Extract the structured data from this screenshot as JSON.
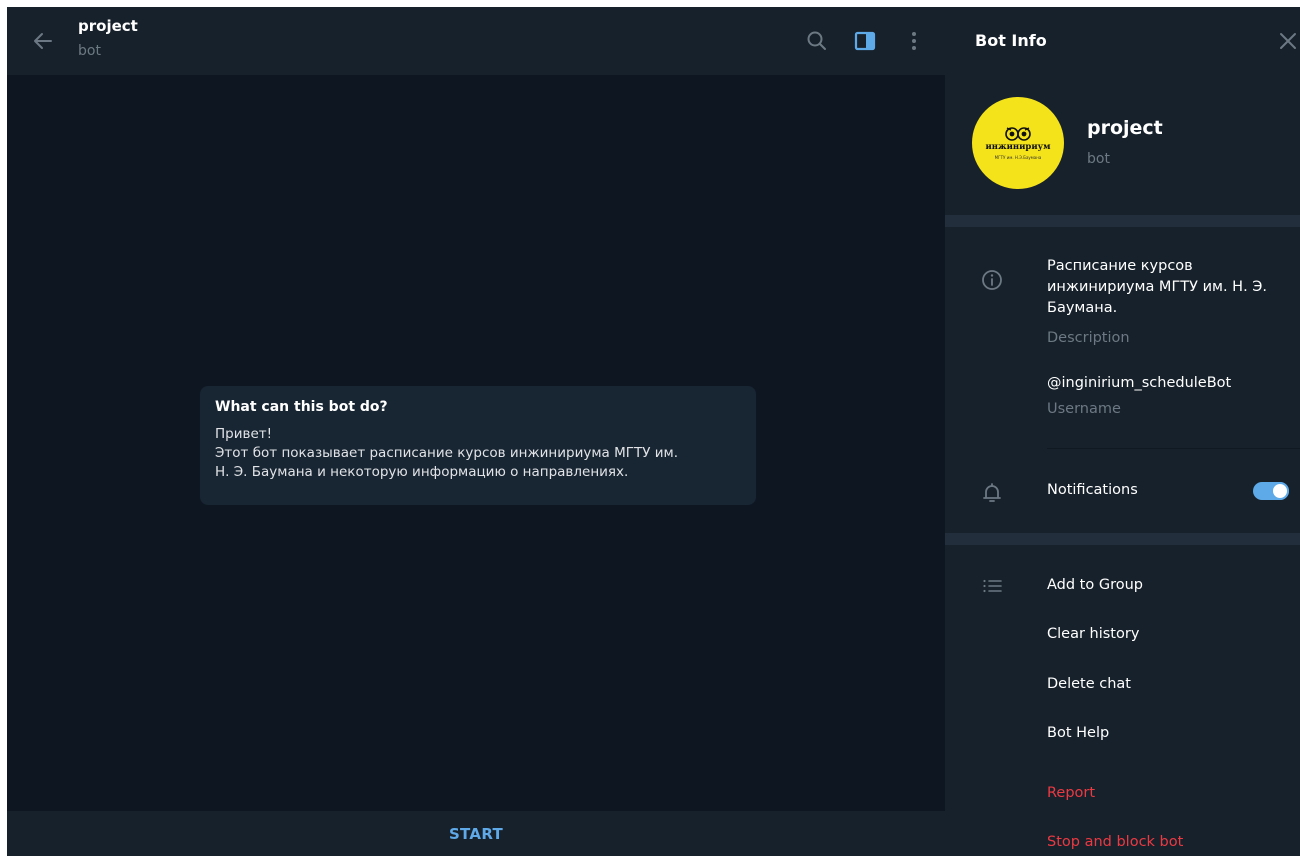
{
  "chat": {
    "title": "project",
    "subtitle": "bot",
    "message": {
      "title": "What can this bot do?",
      "lines": [
        "Привет!",
        "Этот бот показывает расписание курсов инжинириума МГТУ им.",
        "Н. Э. Баумана и некоторую информацию о направлениях."
      ]
    },
    "start_label": "START",
    "header_icons": [
      "back-arrow-icon",
      "search-icon",
      "sidebar-panel-icon",
      "more-vertical-icon"
    ]
  },
  "info": {
    "title": "Bot Info",
    "avatar": {
      "brand": "инжинириум",
      "sub": "МГТУ им. Н.Э.Баумана"
    },
    "name": "project",
    "status": "bot",
    "description": {
      "lines": [
        "Расписание курсов",
        "инжинириума МГТУ им. Н. Э.",
        "Баумана."
      ],
      "label": "Description"
    },
    "username": {
      "value": "@inginirium_scheduleBot",
      "label": "Username"
    },
    "notifications": {
      "label": "Notifications",
      "enabled": true
    },
    "actions": [
      "Add to Group",
      "Clear history",
      "Delete chat",
      "Bot Help"
    ],
    "danger_actions": [
      "Report",
      "Stop and block bot"
    ]
  },
  "colors": {
    "chat_bg": "#0e1621",
    "panel_bg": "#17212b",
    "bubble_bg": "#182533",
    "accent": "#5eaae8",
    "danger": "#ec3942",
    "muted": "#6c7883",
    "avatar_bg": "#f4e21b"
  }
}
